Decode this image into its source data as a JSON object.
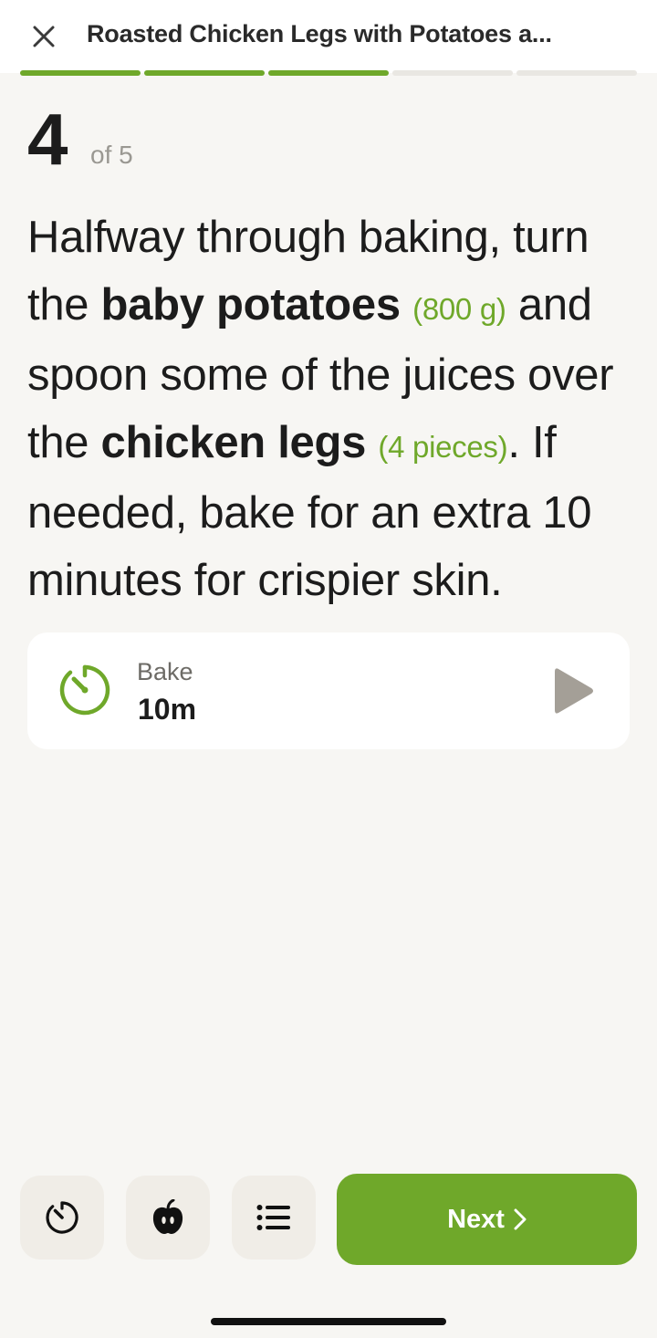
{
  "header": {
    "title": "Roasted Chicken Legs with Potatoes a...",
    "close_icon": "close-icon"
  },
  "progress": {
    "total_steps": 5,
    "completed_segments": 3
  },
  "step": {
    "number": "4",
    "of_label": "of 5"
  },
  "instruction": {
    "part1": "Halfway through baking, turn the ",
    "ingredient1": "baby potatoes",
    "qty1": "(800 g)",
    "part2": " and spoon some of the juices over the ",
    "ingredient2": "chicken legs",
    "qty2": "(4 pieces)",
    "part3": ". If needed, bake for an extra 10 minutes for crispier skin."
  },
  "timer": {
    "label": "Bake",
    "value": "10m",
    "icon": "timer-icon",
    "action_icon": "play-icon"
  },
  "bottom_bar": {
    "timer_button_icon": "timer-icon",
    "ingredients_button_icon": "apple-icon",
    "steps_button_icon": "list-icon",
    "next_label": "Next"
  },
  "colors": {
    "accent": "#6fa82a",
    "background": "#f7f6f3",
    "card": "#ffffff",
    "button_bg": "#f0ede7",
    "play": "#a49f97"
  }
}
